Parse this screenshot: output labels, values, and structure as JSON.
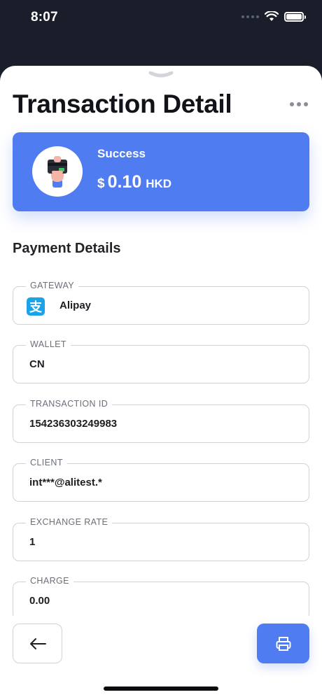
{
  "status_bar": {
    "time": "8:07"
  },
  "header": {
    "title": "Transaction Detail"
  },
  "summary": {
    "status": "Success",
    "currency_symbol": "$",
    "amount": "0.10",
    "currency": "HKD"
  },
  "section": {
    "title": "Payment Details"
  },
  "fields": [
    {
      "label": "GATEWAY",
      "value": "Alipay",
      "icon": "alipay-icon"
    },
    {
      "label": "WALLET",
      "value": "CN"
    },
    {
      "label": "TRANSACTION ID",
      "value": "154236303249983"
    },
    {
      "label": "CLIENT",
      "value": "int***@alitest.*"
    },
    {
      "label": "EXCHANGE RATE",
      "value": "1"
    },
    {
      "label": "CHARGE",
      "value": "0.00"
    }
  ],
  "colors": {
    "accent": "#4f7cf0",
    "alipay": "#1aa3e8",
    "background_dark": "#1a1e2b"
  },
  "icons": {
    "more": "more-horizontal-icon",
    "back": "arrow-left-icon",
    "print": "printer-icon",
    "wifi": "wifi-icon",
    "battery": "battery-icon",
    "card": "card-in-hand-icon"
  },
  "alipay_glyph": "支"
}
